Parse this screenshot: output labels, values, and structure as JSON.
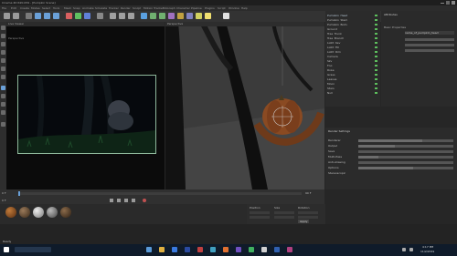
{
  "window": {
    "title": "Cinema 4D R20.059 - [Pumpkin Scene]"
  },
  "menu": [
    "File",
    "Edit",
    "Create",
    "Modes",
    "Select",
    "Tools",
    "Mesh",
    "Snap",
    "Animate",
    "Simulate",
    "Tracker",
    "Render",
    "Sculpt",
    "Motion Tracker",
    "MoGraph",
    "Character",
    "Pipeline",
    "Plugins",
    "Script",
    "Window",
    "Help"
  ],
  "left_viewport": {
    "label": "Perspective",
    "subtitle": "Live Viewer"
  },
  "right_viewport": {
    "label": "Perspective"
  },
  "objects": {
    "items": [
      "Pumpkin_Head",
      "Pumpkin_Stem",
      "Pumpkin_Body",
      "Ground",
      "Tree_Trunk",
      "Tree_Branch",
      "Light_Key",
      "Light_Fill",
      "Light_Rim",
      "Camera",
      "Sky",
      "Fog",
      "Rope",
      "Grass",
      "Leaves",
      "Moon",
      "Stars",
      "Null"
    ]
  },
  "attributes": {
    "title": "Attributes",
    "tab": "Basic Properties",
    "field": "name_of_pumpkin_head"
  },
  "render_settings": {
    "title": "Render Settings",
    "rows": [
      "Renderer",
      "Output",
      "Save",
      "Multi-Pass",
      "Anti-Aliasing",
      "Options",
      "Stereoscopic"
    ]
  },
  "timeline": {
    "start": "0 F",
    "end": "90 F",
    "current": "0 F"
  },
  "coordinates": {
    "labels": [
      "Position",
      "Size",
      "Rotation"
    ],
    "apply_label": "Apply"
  },
  "statusbar": {
    "text": "Ready"
  },
  "taskbar": {
    "time": "4:17 PM",
    "date": "11/2/2019"
  }
}
